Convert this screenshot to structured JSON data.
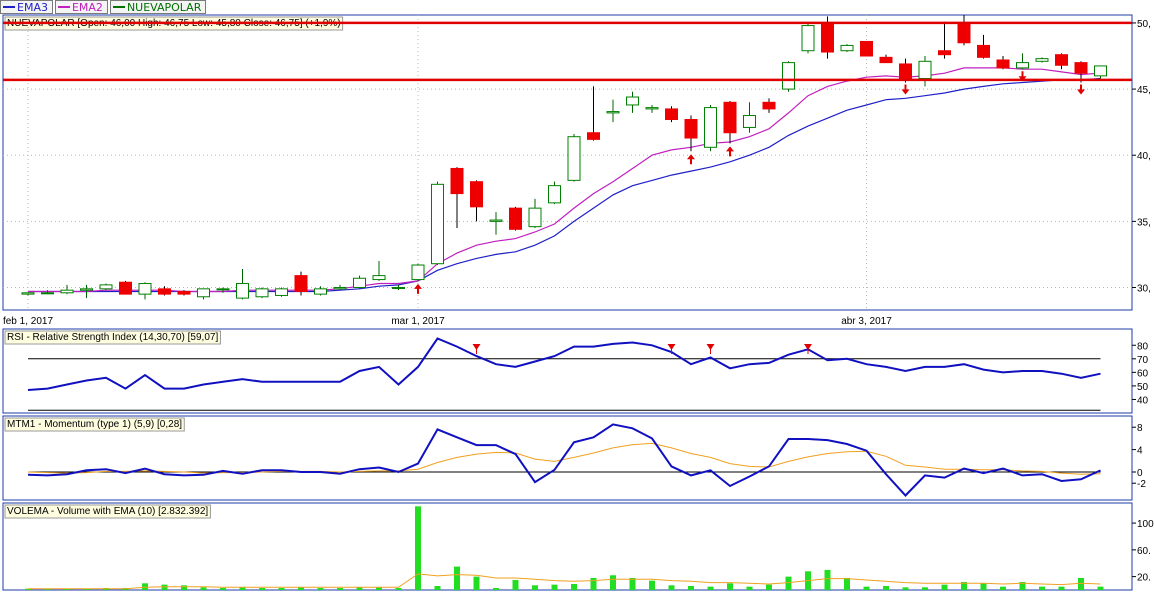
{
  "legend": [
    {
      "label": "EMA3",
      "color": "#2020c8"
    },
    {
      "label": "EMA2",
      "color": "#c020c0"
    },
    {
      "label": "NUEVAPOLAR",
      "color": "#007000"
    }
  ],
  "panels": {
    "price": {
      "label": "NUEVAPOLAR [Open: 46,00  High: 46,75  Low: 45,80  Close: 46,75] (+1,9%)"
    },
    "rsi": {
      "label": "RSI - Relative Strength Index (14,30,70) [59,07]"
    },
    "mtm": {
      "label": "MTM1 - Momentum (type 1) (5,9) [0,28]"
    },
    "vol": {
      "label": "VOLEMA - Volume with EMA (10) [2.832.392]"
    }
  },
  "chart_data": [
    {
      "type": "candlestick",
      "name": "price",
      "ylim": [
        28.3,
        50.6
      ],
      "yticks": [
        30,
        35,
        40,
        45,
        50
      ],
      "ytick_labels": [
        "30,",
        "35,",
        "40,",
        "45,",
        "50,"
      ],
      "xtick_labels": [
        {
          "i": 0,
          "label": "feb 1, 2017"
        },
        {
          "i": 20,
          "label": "mar 1, 2017"
        },
        {
          "i": 43,
          "label": "abr 3, 2017"
        }
      ],
      "hlines": [
        {
          "y": 50.0,
          "color": "#e00000"
        },
        {
          "y": 45.7,
          "color": "#e00000"
        }
      ],
      "candles": [
        [
          29.5,
          29.6,
          29.4,
          29.6
        ],
        [
          29.6,
          29.8,
          29.5,
          29.6
        ],
        [
          29.6,
          30.2,
          29.5,
          29.8
        ],
        [
          29.8,
          30.2,
          29.2,
          29.9
        ],
        [
          29.9,
          30.3,
          29.8,
          30.2
        ],
        [
          30.4,
          30.5,
          29.5,
          29.5
        ],
        [
          29.5,
          30.4,
          29.1,
          30.3
        ],
        [
          29.9,
          30.1,
          29.4,
          29.5
        ],
        [
          29.7,
          29.8,
          29.4,
          29.5
        ],
        [
          29.3,
          29.9,
          29.1,
          29.9
        ],
        [
          29.9,
          30.0,
          29.6,
          29.9
        ],
        [
          29.2,
          31.4,
          29.1,
          30.3
        ],
        [
          29.3,
          30.0,
          29.2,
          29.9
        ],
        [
          29.4,
          30.0,
          29.3,
          29.9
        ],
        [
          30.9,
          31.2,
          29.4,
          29.7
        ],
        [
          29.5,
          30.1,
          29.4,
          29.9
        ],
        [
          29.9,
          30.2,
          29.8,
          30.0
        ],
        [
          30.0,
          30.9,
          29.9,
          30.7
        ],
        [
          30.6,
          32.0,
          30.5,
          30.9
        ],
        [
          30.0,
          30.2,
          29.8,
          30.0
        ],
        [
          30.6,
          31.8,
          30.5,
          31.7
        ],
        [
          31.8,
          38.0,
          31.7,
          37.8
        ],
        [
          39.0,
          39.1,
          34.5,
          37.1
        ],
        [
          38.0,
          38.1,
          35.0,
          36.1
        ],
        [
          35.0,
          35.7,
          34.0,
          35.1
        ],
        [
          36.0,
          36.1,
          34.3,
          34.4
        ],
        [
          34.6,
          36.7,
          34.5,
          36.0
        ],
        [
          36.4,
          38.0,
          36.3,
          37.7
        ],
        [
          38.1,
          41.6,
          38.0,
          41.4
        ],
        [
          41.7,
          45.2,
          41.1,
          41.2
        ],
        [
          43.2,
          44.2,
          42.5,
          43.3
        ],
        [
          43.8,
          44.8,
          43.2,
          44.4
        ],
        [
          43.5,
          43.8,
          43.2,
          43.6
        ],
        [
          43.5,
          43.7,
          42.5,
          42.7
        ],
        [
          42.7,
          43.0,
          40.3,
          41.3
        ],
        [
          40.6,
          43.8,
          40.3,
          43.6
        ],
        [
          44.0,
          44.1,
          40.9,
          41.7
        ],
        [
          42.1,
          44.0,
          41.7,
          43.0
        ],
        [
          44.0,
          44.3,
          43.2,
          43.5
        ],
        [
          45.0,
          47.1,
          44.8,
          47.0
        ],
        [
          47.9,
          50.1,
          47.7,
          49.8
        ],
        [
          50.0,
          50.5,
          47.3,
          47.8
        ],
        [
          47.9,
          48.4,
          47.8,
          48.3
        ],
        [
          48.6,
          48.6,
          47.5,
          47.5
        ],
        [
          47.4,
          47.6,
          47.0,
          47.0
        ],
        [
          46.9,
          47.3,
          45.5,
          45.8
        ],
        [
          45.8,
          47.5,
          45.2,
          47.1
        ],
        [
          47.9,
          50.1,
          47.3,
          47.6
        ],
        [
          50.0,
          50.6,
          48.3,
          48.5
        ],
        [
          48.3,
          49.1,
          47.3,
          47.4
        ],
        [
          47.2,
          47.5,
          46.5,
          46.6
        ],
        [
          46.6,
          47.7,
          46.5,
          47.0
        ],
        [
          47.1,
          47.4,
          47.0,
          47.3
        ],
        [
          47.6,
          47.7,
          46.5,
          46.8
        ],
        [
          47.0,
          47.1,
          45.5,
          46.2
        ],
        [
          46.0,
          46.75,
          45.8,
          46.75
        ]
      ],
      "ema2": [
        29.7,
        29.7,
        29.7,
        29.7,
        29.8,
        29.8,
        29.8,
        29.8,
        29.7,
        29.7,
        29.7,
        29.8,
        29.8,
        29.8,
        29.8,
        29.8,
        29.9,
        30.1,
        30.3,
        30.3,
        30.5,
        31.8,
        32.6,
        33.2,
        33.5,
        33.7,
        34.2,
        34.8,
        36.0,
        37.1,
        38.0,
        39.0,
        40.0,
        40.4,
        40.6,
        40.9,
        41.0,
        41.4,
        42.0,
        43.2,
        44.5,
        45.2,
        45.6,
        45.9,
        46.0,
        45.9,
        46.0,
        46.2,
        46.6,
        46.6,
        46.6,
        46.5,
        46.5,
        46.3,
        46.1,
        46.2
      ],
      "ema3": [
        29.7,
        29.7,
        29.7,
        29.7,
        29.7,
        29.7,
        29.7,
        29.7,
        29.7,
        29.7,
        29.7,
        29.7,
        29.7,
        29.7,
        29.7,
        29.7,
        29.8,
        29.9,
        30.1,
        30.2,
        30.5,
        31.3,
        31.8,
        32.2,
        32.5,
        32.7,
        33.2,
        33.9,
        35.0,
        36.0,
        37.0,
        37.7,
        38.1,
        38.5,
        38.8,
        39.1,
        39.5,
        40.0,
        40.6,
        41.5,
        42.2,
        42.8,
        43.4,
        43.8,
        44.2,
        44.3,
        44.5,
        44.7,
        45.0,
        45.2,
        45.4,
        45.5,
        45.6,
        45.7,
        45.7,
        45.8
      ],
      "up_arrows": [
        20,
        34,
        36
      ],
      "down_arrows": [
        45,
        51,
        54
      ]
    },
    {
      "type": "line",
      "name": "rsi",
      "ylim": [
        30,
        92
      ],
      "yticks": [
        40,
        50,
        60,
        70,
        80
      ],
      "ytick_labels": [
        "40",
        "50",
        "60",
        "70",
        "80"
      ],
      "hlines": [
        {
          "y": 70,
          "color": "#000000"
        },
        {
          "y": 32,
          "color": "#000000"
        }
      ],
      "values": [
        47,
        48,
        51,
        54,
        56,
        48,
        58,
        48,
        48,
        51,
        53,
        55,
        53,
        53,
        53,
        53,
        53,
        61,
        64,
        51,
        64,
        85,
        79,
        72,
        66,
        64,
        68,
        72,
        79,
        79,
        81,
        82,
        80,
        75,
        66,
        71,
        63,
        66,
        67,
        73,
        77,
        69,
        70,
        66,
        64,
        61,
        64,
        64,
        66,
        62,
        60,
        61,
        61,
        59,
        56,
        59
      ],
      "down_arrows": [
        23,
        33,
        35,
        40
      ]
    },
    {
      "type": "line",
      "name": "mtm",
      "ylim": [
        -5,
        10
      ],
      "yticks": [
        -2,
        0,
        4,
        8
      ],
      "ytick_labels": [
        "-2",
        "0",
        "4",
        "8"
      ],
      "hlines": [
        {
          "y": 0,
          "color": "#000000"
        }
      ],
      "values": [
        -0.5,
        -0.6,
        -0.4,
        0.3,
        0.5,
        -0.2,
        0.6,
        -0.4,
        -0.6,
        -0.5,
        0.2,
        -0.3,
        0.3,
        0.3,
        0.0,
        0.0,
        -0.3,
        0.5,
        0.8,
        0.0,
        1.5,
        7.6,
        6.2,
        4.8,
        4.8,
        3.2,
        -1.8,
        0.4,
        5.3,
        6.2,
        8.5,
        7.8,
        6.0,
        1.0,
        -0.6,
        0.3,
        -2.5,
        -0.8,
        1.0,
        5.9,
        5.9,
        5.7,
        5.0,
        3.8,
        -0.4,
        -4.2,
        -0.6,
        -1.0,
        0.6,
        -0.2,
        0.6,
        -0.6,
        -0.4,
        -1.6,
        -1.3,
        0.28
      ],
      "signal": [
        0.0,
        -0.1,
        -0.2,
        -0.1,
        0.1,
        0.1,
        0.2,
        0.1,
        0.0,
        -0.2,
        -0.1,
        -0.1,
        0.0,
        0.1,
        0.1,
        0.1,
        0.0,
        0.1,
        0.2,
        0.2,
        0.5,
        1.7,
        2.6,
        3.2,
        3.5,
        3.4,
        2.3,
        1.9,
        2.6,
        3.4,
        4.3,
        4.9,
        5.1,
        4.3,
        3.3,
        2.6,
        1.5,
        1.0,
        0.9,
        1.9,
        2.7,
        3.3,
        3.6,
        3.7,
        2.8,
        1.2,
        0.9,
        0.5,
        0.5,
        0.4,
        0.4,
        0.2,
        0.1,
        -0.2,
        -0.4,
        -0.3
      ]
    },
    {
      "type": "bar",
      "name": "vol",
      "ylim": [
        0,
        130
      ],
      "yticks": [
        20,
        60,
        100
      ],
      "ytick_labels": [
        "20.",
        "60.",
        "100."
      ],
      "values": [
        2,
        2,
        2,
        2,
        3,
        3,
        10,
        8,
        7,
        4,
        3,
        4,
        3,
        3,
        4,
        3,
        3,
        4,
        4,
        3,
        125,
        6,
        35,
        20,
        3,
        15,
        7,
        8,
        9,
        18,
        22,
        18,
        14,
        7,
        6,
        5,
        10,
        5,
        8,
        20,
        28,
        30,
        18,
        5,
        6,
        4,
        4,
        8,
        12,
        10,
        5,
        12,
        5,
        5,
        18,
        5
      ],
      "ema": [
        2,
        2,
        2,
        2,
        2,
        2,
        4,
        5,
        5,
        5,
        4,
        4,
        4,
        4,
        4,
        4,
        4,
        4,
        4,
        4,
        24,
        21,
        23,
        22,
        18,
        18,
        16,
        14,
        13,
        14,
        16,
        16,
        16,
        14,
        13,
        11,
        11,
        10,
        9,
        11,
        14,
        17,
        17,
        15,
        13,
        11,
        10,
        10,
        10,
        10,
        9,
        10,
        9,
        8,
        10,
        9
      ]
    }
  ]
}
